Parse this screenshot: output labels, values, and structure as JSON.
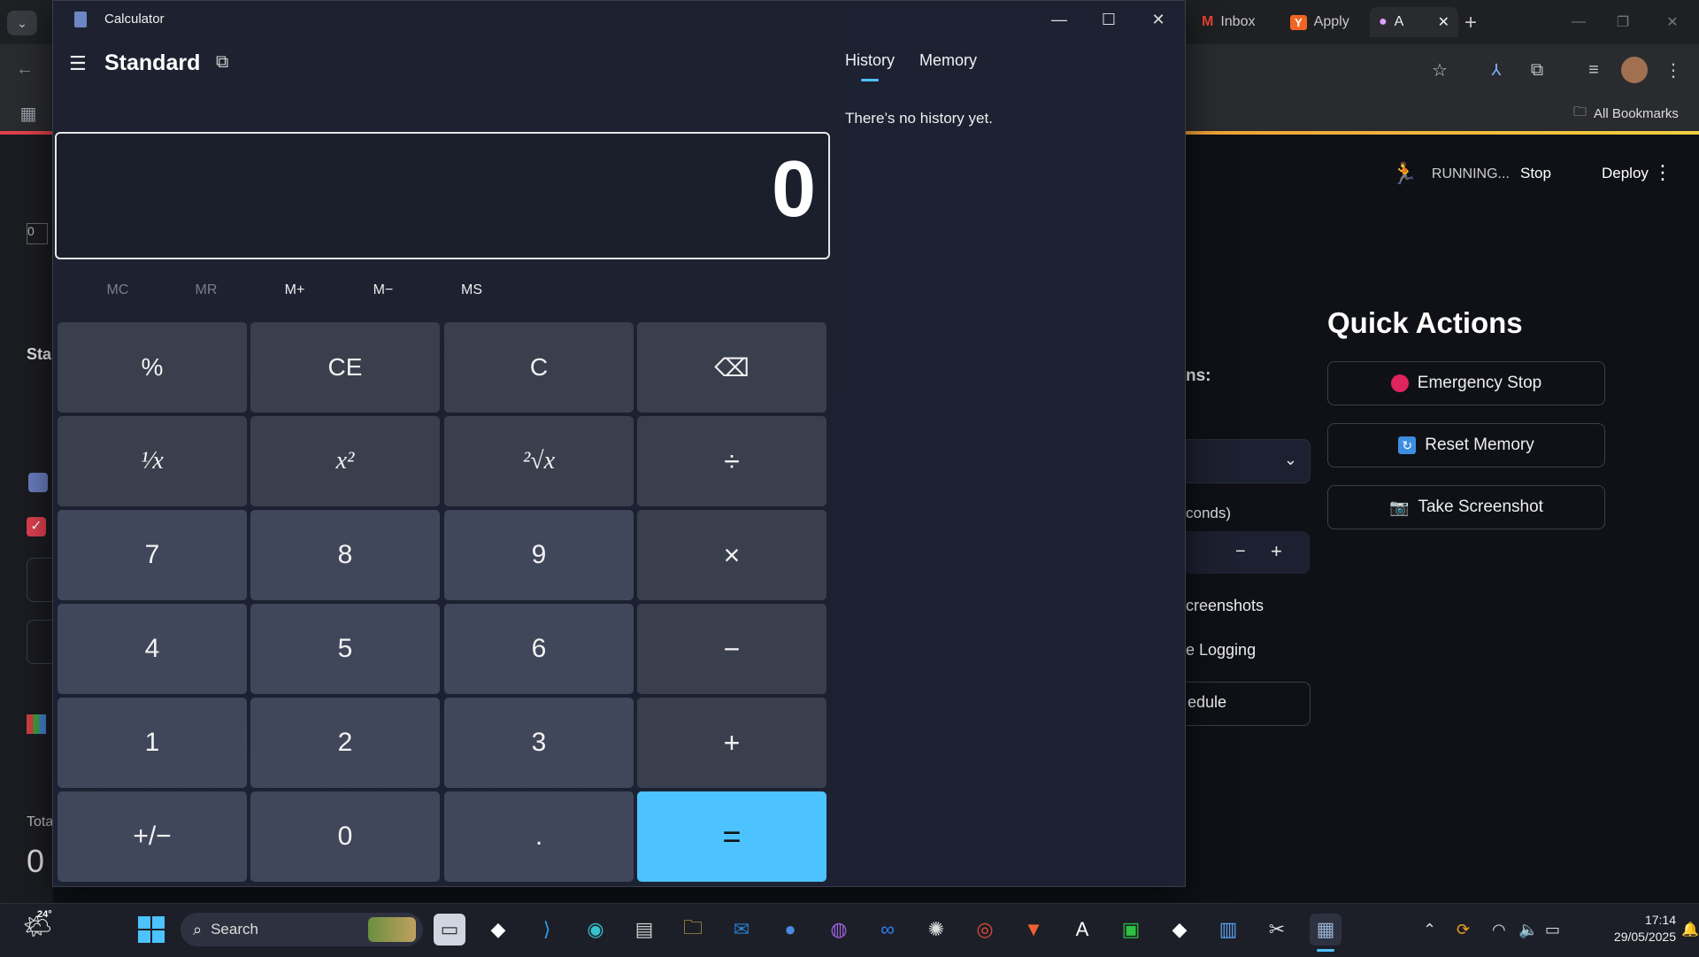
{
  "browser": {
    "tabs": [
      {
        "label": "Inbox",
        "icon": "gmail-icon"
      },
      {
        "label": "Apply",
        "icon": "y-icon"
      },
      {
        "label": "A",
        "icon": "robot-icon"
      }
    ],
    "bookmarks_label": "All Bookmarks",
    "app_header": {
      "status": "RUNNING...",
      "stop_label": "Stop",
      "deploy_label": "Deploy"
    },
    "quick_actions": {
      "title": "Quick Actions",
      "buttons": [
        {
          "label": "Emergency Stop",
          "icon": "red-circle-icon"
        },
        {
          "label": "Reset Memory",
          "icon": "refresh-icon"
        },
        {
          "label": "Take Screenshot",
          "icon": "camera-icon"
        }
      ]
    },
    "left_fragments": {
      "sta": "Sta",
      "tota": "Tota",
      "zero": "0",
      "o": "0"
    },
    "middle_fragments": {
      "ns": "ns:",
      "conds": "conds)",
      "screenshots": "creenshots",
      "logging": "e Logging",
      "schedule": "edule",
      "minus": "−",
      "plus": "+"
    }
  },
  "calculator": {
    "window_title": "Calculator",
    "mode": "Standard",
    "display_value": "0",
    "memory_buttons": [
      "MC",
      "MR",
      "M+",
      "M−",
      "MS"
    ],
    "keys": [
      [
        "%",
        "CE",
        "C",
        "⌫"
      ],
      [
        "¹⁄x",
        "x²",
        "²√x",
        "÷"
      ],
      [
        "7",
        "8",
        "9",
        "×"
      ],
      [
        "4",
        "5",
        "6",
        "−"
      ],
      [
        "1",
        "2",
        "3",
        "+"
      ],
      [
        "+/−",
        "0",
        ".",
        "="
      ]
    ],
    "panel_tabs": [
      "History",
      "Memory"
    ],
    "history_empty": "There’s no history yet."
  },
  "taskbar": {
    "weather": "24°",
    "search_placeholder": "Search",
    "time": "17:14",
    "date": "29/05/2025"
  },
  "colors": {
    "accent": "#4cc2ff",
    "key": "#3a3f4d",
    "key_num": "#41475a",
    "window_bg": "#1f2430"
  }
}
